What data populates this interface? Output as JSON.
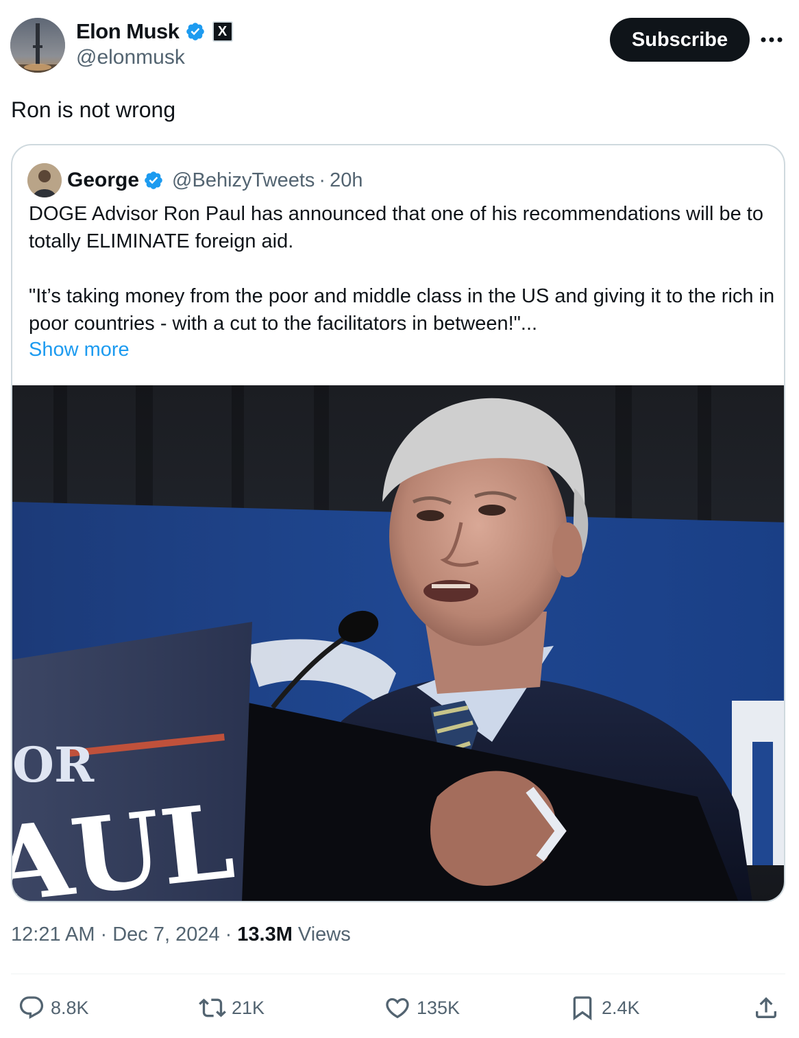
{
  "author": {
    "name": "Elon Musk",
    "handle": "@elonmusk",
    "x_badge": "X"
  },
  "toolbar": {
    "subscribe_label": "Subscribe"
  },
  "tweet": {
    "text": "Ron is not wrong"
  },
  "quote": {
    "name": "George",
    "handle": "@BehizyTweets",
    "separator": "·",
    "time": "20h",
    "paragraph1": "DOGE Advisor Ron Paul has announced that one of his recommendations will be to totally ELIMINATE foreign aid.",
    "paragraph2": "\"It’s taking money from the poor and middle class in the US and giving it to the rich in poor countries  - with a cut to the facilitators in between!\"...",
    "show_more": "Show more",
    "photo_sign_text_1": "OR",
    "photo_sign_text_2": "AUL"
  },
  "meta": {
    "time": "12:21 AM",
    "sep1": "·",
    "date": "Dec 7, 2024",
    "sep2": "·",
    "views_count": "13.3M",
    "views_label": "Views"
  },
  "actions": {
    "replies": "8.8K",
    "reposts": "21K",
    "likes": "135K",
    "bookmarks": "2.4K"
  },
  "colors": {
    "verified_blue": "#1d9bf0",
    "text_primary": "#0f1419",
    "text_secondary": "#536471",
    "border": "#cfd9de"
  },
  "icons": [
    "verified-icon",
    "x-logo-icon",
    "more-icon",
    "reply-icon",
    "repost-icon",
    "like-icon",
    "bookmark-icon",
    "share-icon"
  ]
}
